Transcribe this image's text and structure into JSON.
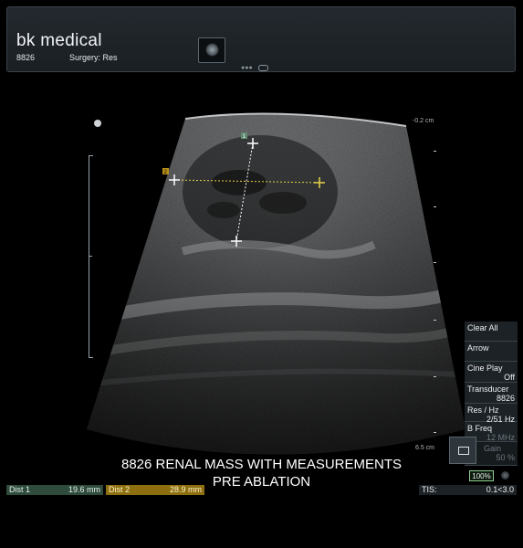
{
  "header": {
    "brand": "bk medical",
    "transducer": "8826",
    "application": "Surgery: Res",
    "preview_icon": "image-thumbnail-icon"
  },
  "image": {
    "depth_top": "-0.2 cm",
    "depth_bottom": "6.5 cm",
    "markers": {
      "m1": "1",
      "m2": "2"
    }
  },
  "caption": {
    "line1": "8826 RENAL MASS WITH MEASUREMENTS",
    "line2": "PRE ABLATION"
  },
  "menu": {
    "clear_all": "Clear All",
    "arrow": "Arrow",
    "cine_play_label": "Cine Play",
    "cine_play_value": "Off",
    "transducer_label": "Transducer",
    "transducer_value": "8826",
    "res_label": "Res / Hz",
    "res_value": "2/51 Hz",
    "bfreq_label": "B Freq",
    "bfreq_value": "12 MHz",
    "gain_label": "Gain",
    "gain_value": "50 %",
    "zoom": "100%"
  },
  "measurements": {
    "dist1_label": "Dist 1",
    "dist1_value": "19.6 mm",
    "dist2_label": "Dist 2",
    "dist2_value": "28.9 mm"
  },
  "tis": {
    "label": "TIS:",
    "value": "0.1<3.0"
  },
  "colors": {
    "dist1": "#5f8a72",
    "dist2": "#b7901a",
    "caliper1": "#ffffff",
    "caliper2": "#e8d34a"
  }
}
